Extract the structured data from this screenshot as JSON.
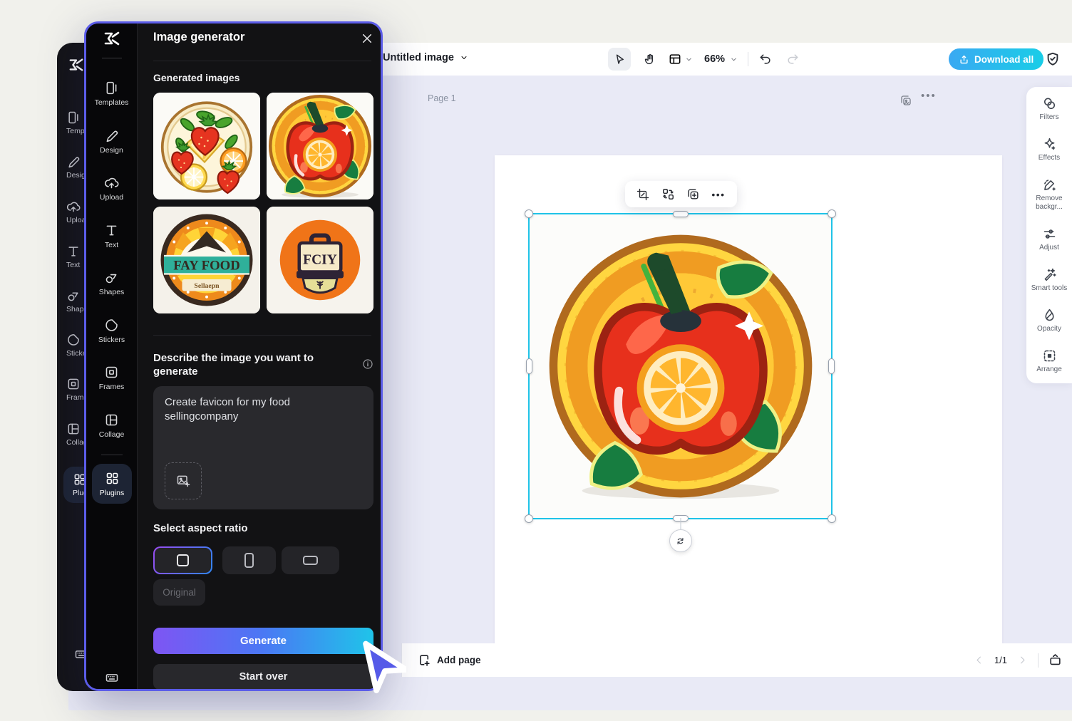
{
  "colors": {
    "accent": "#5b5ce8",
    "selection_cyan": "#1fc3e8",
    "generate_gradient_start": "#7e55f3",
    "generate_gradient_mid": "#4a78f4",
    "generate_gradient_end": "#1fc4e9",
    "download_gradient_start": "#3aa9f2",
    "download_gradient_end": "#19cde7",
    "panel_bg": "#121214"
  },
  "sidebar_items": [
    "Templates",
    "Design",
    "Upload",
    "Text",
    "Shapes",
    "Stickers",
    "Frames",
    "Collage",
    "Plugins"
  ],
  "overlay": {
    "title": "Image generator",
    "generated_heading": "Generated images",
    "thumbnails": {
      "fay_food_line1": "FAY FOOD",
      "fay_food_line2": "Sellaepn",
      "bag_text": "FCIY"
    },
    "prompt_label": "Describe the image you want to generate",
    "prompt_value": "Create favicon for my food sellingcompany",
    "aspect_label": "Select aspect ratio",
    "original_label": "Original",
    "generate_label": "Generate",
    "start_over_label": "Start over"
  },
  "topbar": {
    "document_title": "Untitled image",
    "zoom_level": "66%",
    "download_all_label": "Download all"
  },
  "canvas": {
    "page_label": "Page 1"
  },
  "right_rail": {
    "items": [
      "Filters",
      "Effects",
      "Remove backgr...",
      "Adjust",
      "Smart tools",
      "Opacity",
      "Arrange"
    ]
  },
  "bottom_bar": {
    "add_page_label": "Add page",
    "pagination": "1/1"
  }
}
